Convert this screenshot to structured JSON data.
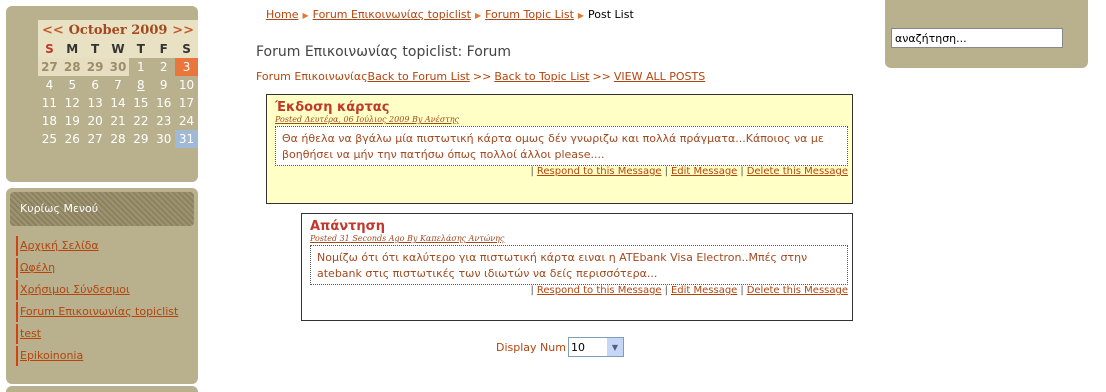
{
  "calendar": {
    "prev": "<<",
    "next": ">>",
    "title": "October 2009",
    "days_of_week": [
      "S",
      "M",
      "T",
      "W",
      "T",
      "F",
      "S"
    ],
    "rows": [
      [
        "27",
        "28",
        "29",
        "30",
        "1",
        "2",
        "3"
      ],
      [
        "4",
        "5",
        "6",
        "7",
        "8",
        "9",
        "10"
      ],
      [
        "11",
        "12",
        "13",
        "14",
        "15",
        "16",
        "17"
      ],
      [
        "18",
        "19",
        "20",
        "21",
        "22",
        "23",
        "24"
      ],
      [
        "25",
        "26",
        "27",
        "28",
        "29",
        "30",
        "31"
      ]
    ]
  },
  "menu": {
    "title": "Κυρίως Μενού",
    "items": [
      {
        "label": "Αρχική Σελίδα"
      },
      {
        "label": "Ωφέλη"
      },
      {
        "label": "Χρήσιμοι Σύνδεσμοι"
      },
      {
        "label": "Forum Επικοινωνίας topiclist"
      },
      {
        "label": "test"
      },
      {
        "label": "Epikoinonia"
      }
    ]
  },
  "search": {
    "placeholder": "αναζήτηση..."
  },
  "breadcrumb": {
    "home": "Home",
    "topiclist": "Forum Επικοινωνίας topiclist",
    "topic_list": "Forum Topic List",
    "current": "Post List"
  },
  "page_title": "Forum Επικοινωνίας topiclist: Forum",
  "nav": {
    "forum_name": "Forum Επικοινωνίας",
    "back_forum": "Back to Forum List",
    "sep1": ">>",
    "back_topic": "Back to Topic List",
    "sep2": ">>",
    "view_all": "VIEW ALL POSTS"
  },
  "posts": [
    {
      "title": "Έκδοση κάρτας",
      "meta": "Posted Δευτέρα, 06 Ιούλιος 2009 By Ανέστης",
      "body": "Θα ήθελα να βγάλω μία πιστωτική κάρτα ομως δέν γνωριζω και πολλά πράγματα...Κάποιος να με βοηθήσει να μήν την πατήσω όπως πολλοί άλλοι please....",
      "respond": "Respond to this Message",
      "edit": "Edit Message",
      "delete": "Delete this Message"
    },
    {
      "title": "Απάντηση",
      "meta": "Posted 31 Seconds Ago By Καπελάσης Αντώνης",
      "body": "Νομίζω ότι ότι καλύτερο για πιστωτική κάρτα ειναι η ATEbank Visa Electron..Μπές στην atebank στις πιστωτικές των ιδιωτών να δείς περισσότερα...",
      "respond": "Respond to this Message",
      "edit": "Edit Message",
      "delete": "Delete this Message"
    }
  ],
  "display_num": {
    "label": "Display Num",
    "value": "10"
  }
}
